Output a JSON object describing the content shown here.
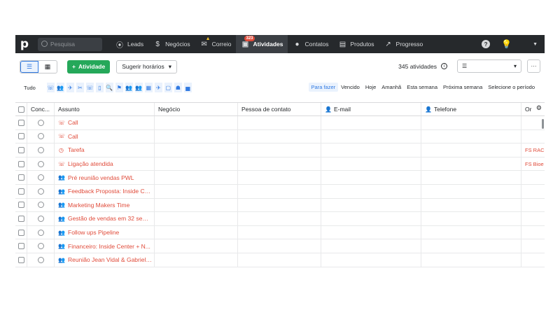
{
  "nav": {
    "logo": "p",
    "search_placeholder": "Pesquisa",
    "items": [
      {
        "label": "Leads",
        "icon": "⦿"
      },
      {
        "label": "Negócios",
        "icon": "$"
      },
      {
        "label": "Correio",
        "icon": "✉"
      },
      {
        "label": "Atividades",
        "icon": "▣",
        "badge": "323"
      },
      {
        "label": "Contatos",
        "icon": "●"
      },
      {
        "label": "Produtos",
        "icon": "▤"
      },
      {
        "label": "Progresso",
        "icon": "↗"
      }
    ],
    "help": "?",
    "bulb": "💡",
    "caret": "▼"
  },
  "toolbar": {
    "add_label": "Atividade",
    "add_plus": "+",
    "suggest_label": "Sugerir horários",
    "count": "345 atividades",
    "info": "i",
    "filter_icon": "☰",
    "more": "···"
  },
  "filters": {
    "all_label": "Tudo",
    "type_icons": [
      "☏",
      "👥",
      "✈",
      "✂",
      "☏",
      "▯",
      "🔍",
      "⚑",
      "👥",
      "👥",
      "▦",
      "✈",
      "▢",
      "☗",
      "▅"
    ],
    "periods": [
      "Para fazer",
      "Vencido",
      "Hoje",
      "Amanhã",
      "Esta semana",
      "Próxima semana",
      "Selecione o período"
    ]
  },
  "table": {
    "headers": {
      "done": "Conc...",
      "subject": "Assunto",
      "deal": "Negócio",
      "person": "Pessoa de contato",
      "email": "E-mail",
      "phone": "Telefone",
      "org": "Or"
    },
    "rows": [
      {
        "icon": "☏",
        "subject": "Call",
        "org": ""
      },
      {
        "icon": "☏",
        "subject": "Call",
        "org": ""
      },
      {
        "icon": "◷",
        "subject": "Tarefa",
        "org": "FS RACI"
      },
      {
        "icon": "☏",
        "subject": "Ligação atendida",
        "org": "FS Bioe"
      },
      {
        "icon": "👥",
        "subject": "Pré reunião vendas PWL",
        "org": ""
      },
      {
        "icon": "👥",
        "subject": "Feedback Proposta: Inside Ce...",
        "org": ""
      },
      {
        "icon": "👥",
        "subject": "Marketing Makers Time",
        "org": ""
      },
      {
        "icon": "👥",
        "subject": "Gestão de vendas em 32 sem...",
        "org": ""
      },
      {
        "icon": "👥",
        "subject": "Follow ups Pipeline",
        "org": ""
      },
      {
        "icon": "👥",
        "subject": "Financeiro: Inside Center + N...",
        "org": ""
      },
      {
        "icon": "👥",
        "subject": "Reunião Jean Vidal & Gabriel ...",
        "org": ""
      }
    ]
  },
  "colors": {
    "accent": "#317ae2",
    "add_button": "#25a85a",
    "overdue": "#e04b3a",
    "nav_bg": "#26292c"
  }
}
